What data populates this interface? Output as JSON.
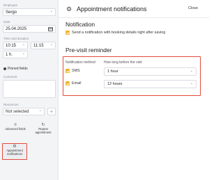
{
  "left": {
    "employee_label": "Employee",
    "employee_value": "Sergo",
    "date_label": "Date",
    "date_value": "25.04.2025",
    "time_label": "Time and duration",
    "time_start": "10:15",
    "time_end": "11:15",
    "duration": "1 h.",
    "pinned_fields": "Pinned fields",
    "comment_label": "Comment",
    "resources_label": "Resources",
    "resources_value": "Not selected",
    "plus_label": "+",
    "tiles": [
      {
        "label": "Advanced fields",
        "icon": "≡"
      },
      {
        "label": "Repeat appointment",
        "icon": "↻"
      },
      {
        "label": "Appointment notifications",
        "icon": "⚙"
      }
    ]
  },
  "header": {
    "title": "Appointment notifications",
    "close_label": "Close"
  },
  "notification": {
    "title": "Notification",
    "send_label": "Send a notification with booking details right after saving",
    "send_checked": true
  },
  "reminder": {
    "title": "Pre-visit reminder",
    "col_method": "Notification method",
    "col_time": "How long before the visit",
    "rows": [
      {
        "method": "SMS",
        "checked": true,
        "time": "1 hour"
      },
      {
        "method": "Email",
        "checked": true,
        "time": "12 hours"
      }
    ]
  },
  "colors": {
    "accent": "#f0b323",
    "highlight": "#e24a3b"
  }
}
